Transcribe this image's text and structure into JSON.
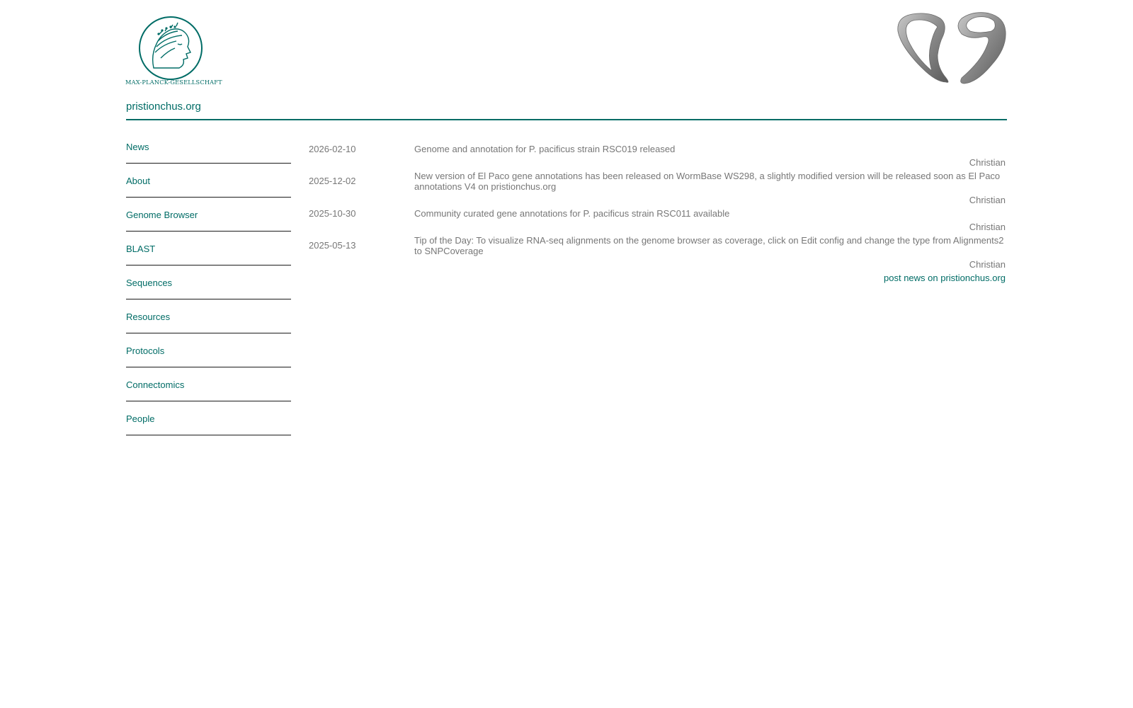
{
  "header": {
    "logo_text": "MAX-PLANCK-GESELLSCHAFT",
    "site_title": "pristionchus.org"
  },
  "sidebar": {
    "items": [
      {
        "label": "News"
      },
      {
        "label": "About"
      },
      {
        "label": "Genome Browser"
      },
      {
        "label": "BLAST"
      },
      {
        "label": "Sequences"
      },
      {
        "label": "Resources"
      },
      {
        "label": "Protocols"
      },
      {
        "label": "Connectomics"
      },
      {
        "label": "People"
      }
    ]
  },
  "news": {
    "items": [
      {
        "date": "2026-02-10",
        "text": "Genome and annotation for P. pacificus strain RSC019 released",
        "author": "Christian"
      },
      {
        "date": "2025-12-02",
        "text": "New version of El Paco gene annotations has been released on WormBase WS298, a slightly modified version will be released soon as El Paco annotations V4 on pristionchus.org",
        "author": "Christian"
      },
      {
        "date": "2025-10-30",
        "text": "Community curated gene annotations for P. pacificus strain RSC011 available",
        "author": "Christian"
      },
      {
        "date": "2025-05-13",
        "text": "Tip of the Day: To visualize RNA-seq alignments on the genome browser as coverage, click on Edit config and change the type from Alignments2 to SNPCoverage",
        "author": "Christian"
      }
    ],
    "post_link": "post news on pristionchus.org"
  },
  "colors": {
    "brand": "#006c66",
    "text_gray": "#777777",
    "worm_gray": "#8a8a8a"
  }
}
